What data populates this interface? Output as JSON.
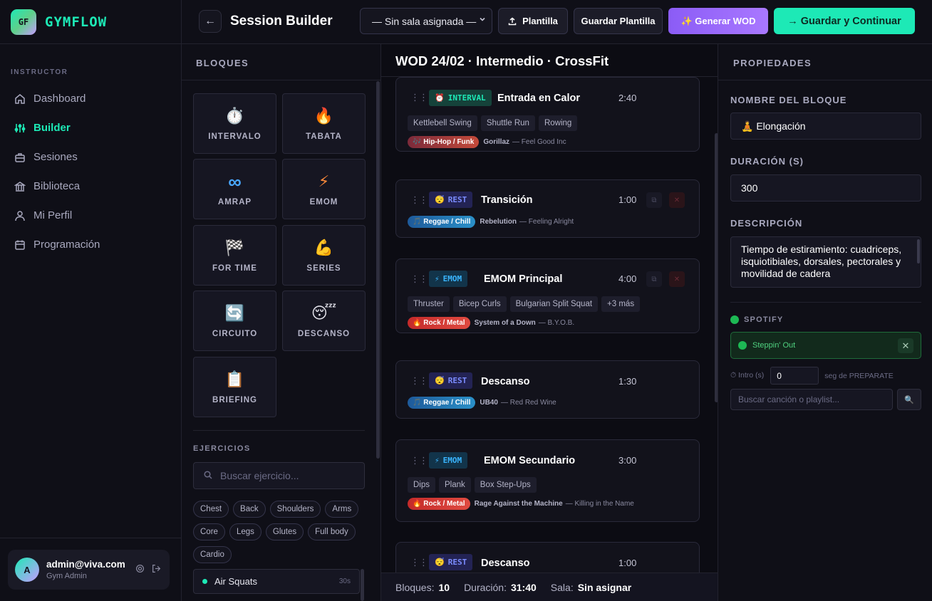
{
  "brand": {
    "logo": "GF",
    "name": "GYMFLOW"
  },
  "sidebar": {
    "section_label": "INSTRUCTOR",
    "items": [
      {
        "label": "Dashboard",
        "icon": "home-icon"
      },
      {
        "label": "Builder",
        "icon": "sliders-icon",
        "active": true
      },
      {
        "label": "Sesiones",
        "icon": "briefcase-icon"
      },
      {
        "label": "Biblioteca",
        "icon": "library-icon"
      },
      {
        "label": "Mi Perfil",
        "icon": "user-icon"
      },
      {
        "label": "Programación",
        "icon": "calendar-icon"
      }
    ],
    "user": {
      "avatar": "A",
      "email": "admin@viva.com",
      "role": "Gym Admin"
    }
  },
  "header": {
    "back_icon": "←",
    "title": "Session Builder",
    "room_select": "— Sin sala asignada —",
    "plantilla": "Plantilla",
    "guardar_plantilla": "Guardar Plantilla",
    "generar_wod": "✨ Generar WOD",
    "guardar_continuar": "→  Guardar y Continuar"
  },
  "blocks": {
    "title": "BLOQUES",
    "items": [
      {
        "icon": "⏱️",
        "label": "INTERVALO"
      },
      {
        "icon": "🔥",
        "label": "TABATA"
      },
      {
        "icon": "∞",
        "label": "AMRAP"
      },
      {
        "icon": "⚡",
        "label": "EMOM"
      },
      {
        "icon": "🏁",
        "label": "FOR TIME"
      },
      {
        "icon": "💪",
        "label": "SERIES"
      },
      {
        "icon": "🔄",
        "label": "CIRCUITO"
      },
      {
        "icon": "😴",
        "label": "DESCANSO"
      },
      {
        "icon": "📋",
        "label": "BRIEFING"
      }
    ]
  },
  "exercises": {
    "title": "EJERCICIOS",
    "search_placeholder": "Buscar ejercicio...",
    "chips": [
      "Chest",
      "Back",
      "Shoulders",
      "Arms",
      "Core",
      "Legs",
      "Glutes",
      "Full body",
      "Cardio"
    ],
    "first_item": {
      "name": "Air Squats",
      "duration": "30s"
    }
  },
  "timeline": {
    "title": "WOD 24/02 · Intermedio · CrossFit",
    "cards": [
      {
        "badge_icon": "⏰",
        "badge": "INTERVAL",
        "name": "Entrada en Calor",
        "duration": "2:40",
        "tags": [
          "Kettlebell Swing",
          "Shuttle Run",
          "Rowing"
        ],
        "genre": "🎶 Hip-Hop / Funk",
        "artist": "Gorillaz",
        "song": "— Feel Good Inc"
      },
      {
        "badge_icon": "😴",
        "badge": "REST",
        "name": "Transición",
        "duration": "1:00",
        "tags": [],
        "genre": "🎵 Reggae / Chill",
        "artist": "Rebelution",
        "song": "— Feeling Alright"
      },
      {
        "badge_icon": "⚡",
        "badge": "EMOM",
        "name": "EMOM Principal",
        "duration": "4:00",
        "tags": [
          "Thruster",
          "Bicep Curls",
          "Bulgarian Split Squat",
          "+3 más"
        ],
        "genre": "🔥 Rock / Metal",
        "artist": "System of a Down",
        "song": "— B.Y.O.B."
      },
      {
        "badge_icon": "😴",
        "badge": "REST",
        "name": "Descanso",
        "duration": "1:30",
        "tags": [],
        "genre": "🎵 Reggae / Chill",
        "artist": "UB40",
        "song": "— Red Red Wine"
      },
      {
        "badge_icon": "⚡",
        "badge": "EMOM",
        "name": "EMOM Secundario",
        "duration": "3:00",
        "tags": [
          "Dips",
          "Plank",
          "Box Step-Ups"
        ],
        "genre": "🔥 Rock / Metal",
        "artist": "Rage Against the Machine",
        "song": "— Killing in the Name"
      },
      {
        "badge_icon": "😴",
        "badge": "REST",
        "name": "Descanso",
        "duration": "1:00",
        "tags": [],
        "genre": "",
        "artist": "",
        "song": ""
      }
    ],
    "footer": {
      "bloques_label": "Bloques:",
      "bloques": "10",
      "duracion_label": "Duración:",
      "duracion": "31:40",
      "sala_label": "Sala:",
      "sala": "Sin asignar"
    }
  },
  "properties": {
    "title": "PROPIEDADES",
    "name_label": "NOMBRE DEL BLOQUE",
    "name_value": "🧘 Elongación",
    "duration_label": "DURACIÓN (S)",
    "duration_value": "300",
    "desc_label": "DESCRIPCIÓN",
    "desc_value": "Tiempo de estiramiento: cuadriceps, isquiotibiales, dorsales, pectorales y movilidad de cadera",
    "spotify_label": "SPOTIFY",
    "spotify_track": "Steppin' Out",
    "intro_label": "⏱ Intro (s)",
    "intro_value": "0",
    "intro_hint": "seg de PREPARATE",
    "song_search_placeholder": "Buscar canción o playlist...",
    "search_btn": "🔍"
  },
  "colors": {
    "accent": "#1de9b6",
    "purple": "#8b5cf6",
    "spotify": "#1db954"
  }
}
